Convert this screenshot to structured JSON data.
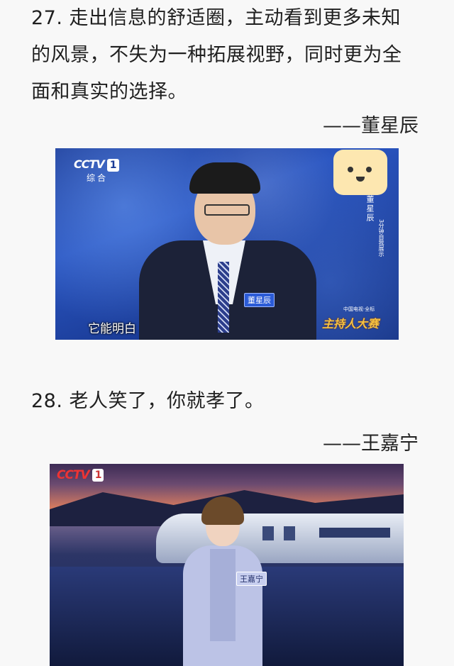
{
  "quote27": {
    "line1": "27. 走出信息的舒适圈，主动看到更多未知",
    "line2": "的风景，不失为一种拓展视野，同时更为全",
    "line3": "面和真实的选择。",
    "author": "——董星辰"
  },
  "image1": {
    "channel_logo": "CCTV",
    "channel_number": "1",
    "channel_sub": "综合",
    "subtitle": "它能明白",
    "name_badge": "董星辰",
    "side_name": "董星辰",
    "side_caption": "3分钟自我展示",
    "show_logo": "主持人大赛",
    "show_top": "中国电视·全标"
  },
  "quote28": {
    "line1": "28. 老人笑了，你就孝了。",
    "author": "——王嘉宁"
  },
  "image2": {
    "channel_logo": "CCTV",
    "channel_number": "1",
    "name_badge": "王嘉宁"
  }
}
